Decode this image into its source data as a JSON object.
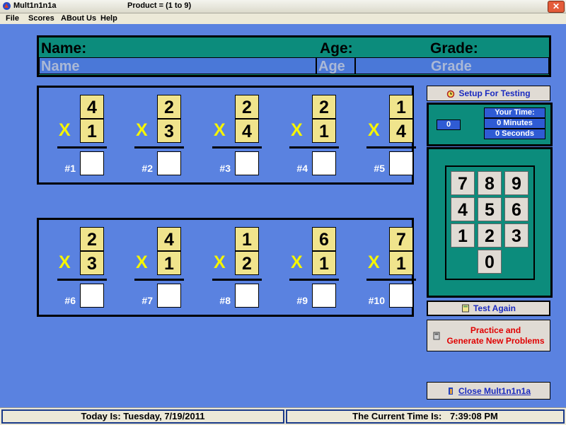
{
  "app_title": "Mult1n1n1a",
  "product_title": "Product = (1 to 9)",
  "menu": [
    "File",
    "Scores",
    "ABout Us",
    "Help"
  ],
  "info": {
    "name_label": "Name:",
    "age_label": "Age:",
    "grade_label": "Grade:",
    "name_placeholder": "Name",
    "age_placeholder": "Age",
    "grade_placeholder": "Grade"
  },
  "problems": [
    {
      "num": "#1",
      "top": "4",
      "bottom": "1"
    },
    {
      "num": "#2",
      "top": "2",
      "bottom": "3"
    },
    {
      "num": "#3",
      "top": "2",
      "bottom": "4"
    },
    {
      "num": "#4",
      "top": "2",
      "bottom": "1"
    },
    {
      "num": "#5",
      "top": "1",
      "bottom": "4"
    },
    {
      "num": "#6",
      "top": "2",
      "bottom": "3"
    },
    {
      "num": "#7",
      "top": "4",
      "bottom": "1"
    },
    {
      "num": "#8",
      "top": "1",
      "bottom": "2"
    },
    {
      "num": "#9",
      "top": "6",
      "bottom": "1"
    },
    {
      "num": "#10",
      "top": "7",
      "bottom": "1"
    }
  ],
  "x_sign": "X",
  "setup_button": "Setup  For Testing",
  "timer": {
    "counter": "0",
    "your_time": "Your Time:",
    "minutes": "0 Minutes",
    "seconds": "0 Seconds"
  },
  "keypad": [
    "7",
    "8",
    "9",
    "4",
    "5",
    "6",
    "1",
    "2",
    "3",
    "0"
  ],
  "test_again_button": "Test Again",
  "practice_button_line1": "Practice and",
  "practice_button_line2": "Generate New Problems",
  "close_button": "Close Mult1n1n1a",
  "status": {
    "today_label": "Today Is:",
    "today_value": "Tuesday, 7/19/2011",
    "time_label": "The Current Time Is:",
    "time_value": "7:39:08 PM"
  },
  "colors": {
    "background": "#5a82e0",
    "panel_teal": "#0c8c7c",
    "digit_yellow": "#f0e48c",
    "x_yellow": "#f5f500",
    "practice_red": "#e00000",
    "close_blue": "#1a2ac0"
  }
}
